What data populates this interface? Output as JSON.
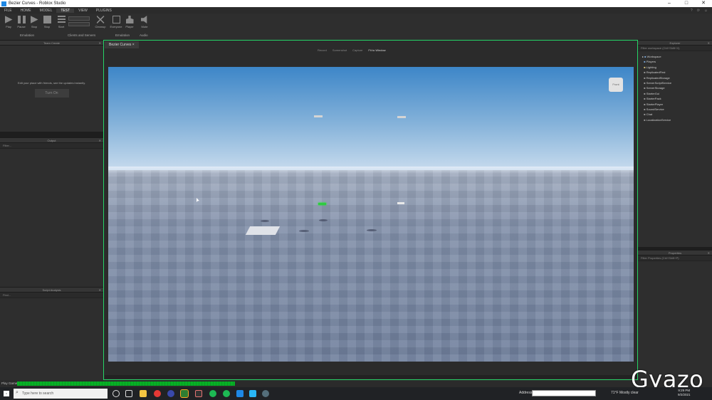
{
  "window": {
    "title": "Bezier Curves - Roblox Studio",
    "controls": [
      "–",
      "□",
      "✕"
    ]
  },
  "menubar": {
    "items": [
      "FILE",
      "HOME",
      "MODEL",
      "TEST",
      "VIEW",
      "PLUGINS"
    ],
    "active": "TEST",
    "right": [
      "?",
      "⟳",
      "☺"
    ]
  },
  "ribbon": {
    "buttons": [
      "Play",
      "Pause",
      "Stop",
      "Start",
      "Players",
      "Cleanup",
      "Everyone",
      "Player",
      "Mute"
    ],
    "groups": [
      "Emulation",
      "Clients and Servers",
      "Emulation",
      "Audio"
    ]
  },
  "panels": {
    "team_create": {
      "title": "Team Create",
      "message": "Edit your place with friends, see the updates instantly.",
      "button": "Turn On"
    },
    "output": {
      "title": "Output",
      "filter": "Filter..."
    },
    "script_analysis": {
      "title": "Script Analysis",
      "filter": "Find..."
    },
    "explorer": {
      "title": "Explorer",
      "filter": "Filter workspace (Ctrl+Shift+X)",
      "items": [
        "Workspace",
        "Players",
        "Lighting",
        "ReplicatedFirst",
        "ReplicatedStorage",
        "ServerScriptService",
        "ServerStorage",
        "StarterGui",
        "StarterPack",
        "StarterPlayer",
        "SoundService",
        "Chat",
        "LocalizationService"
      ]
    },
    "properties": {
      "title": "Properties",
      "filter": "Filter Properties (Ctrl+Shift+P)"
    }
  },
  "game": {
    "tab": "Bezier Curves",
    "tab_close": "×",
    "toolbar": [
      "Record",
      "Screenshot",
      "Capture"
    ],
    "fit": "Fit to Window",
    "viewcube": "Front"
  },
  "statusbar": {
    "text": "Play Game",
    "progress": 1.0
  },
  "taskbar": {
    "search_placeholder": "Type here to search",
    "address_label": "Address",
    "weather": "71°F  Mostly clear",
    "time": "9:29 PM",
    "date": "9/2/2021"
  },
  "watermark": "Gyazo"
}
